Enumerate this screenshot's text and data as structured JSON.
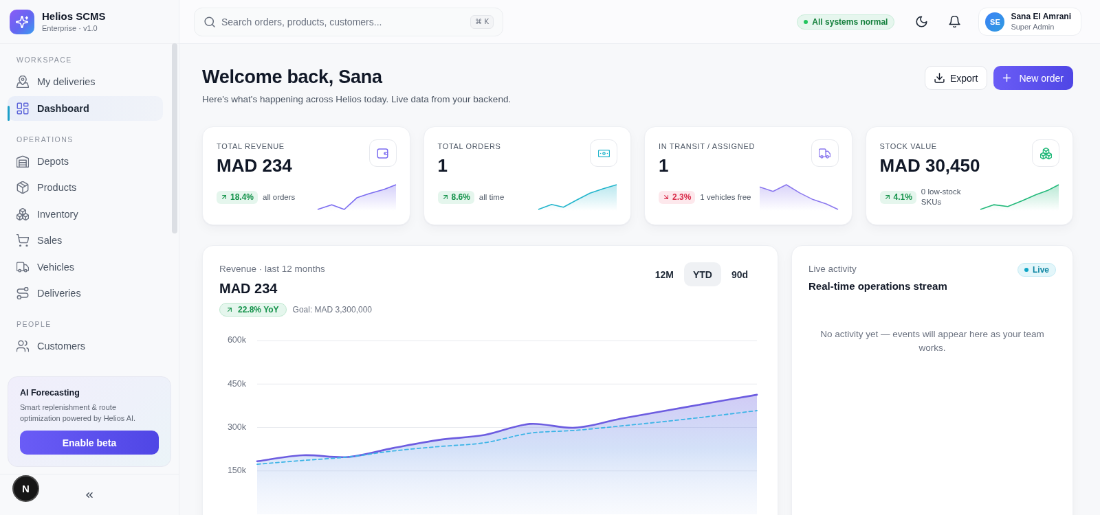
{
  "sidebar": {
    "brand": {
      "name": "Helios SCMS",
      "subtitle": "Enterprise · v1.0"
    },
    "sections": [
      {
        "label": "WORKSPACE",
        "items": [
          {
            "label": "My deliveries",
            "selected": false
          },
          {
            "label": "Dashboard",
            "selected": true
          }
        ]
      },
      {
        "label": "OPERATIONS",
        "items": [
          {
            "label": "Depots",
            "selected": false
          },
          {
            "label": "Products",
            "selected": false
          },
          {
            "label": "Inventory",
            "selected": false
          },
          {
            "label": "Sales",
            "selected": false
          },
          {
            "label": "Vehicles",
            "selected": false
          },
          {
            "label": "Deliveries",
            "selected": false
          }
        ]
      },
      {
        "label": "PEOPLE",
        "items": [
          {
            "label": "Customers",
            "selected": false
          }
        ]
      }
    ],
    "promo": {
      "title": "AI Forecasting",
      "text": "Smart replenishment & route optimization powered by Helios AI.",
      "button": "Enable beta"
    },
    "dev_button": "N"
  },
  "topbar": {
    "search": {
      "placeholder": "Search orders, products, customers...",
      "shortcut": "⌘ K"
    },
    "status": "All systems normal",
    "user": {
      "initials": "SE",
      "name": "Sana El Amrani",
      "role": "Super Admin"
    }
  },
  "header": {
    "title": "Welcome back, Sana",
    "subtitle": "Here's what's happening across Helios today. Live data from your backend.",
    "buttons": [
      {
        "label": "Export",
        "kind": "secondary"
      },
      {
        "label": "New order",
        "kind": "primary"
      }
    ]
  },
  "kpis": [
    {
      "label": "TOTAL REVENUE",
      "value": "MAD 234",
      "delta": "18.4%",
      "down": false,
      "note": "all orders"
    },
    {
      "label": "TOTAL ORDERS",
      "value": "1",
      "delta": "8.6%",
      "down": false,
      "note": "all time"
    },
    {
      "label": "IN TRANSIT / ASSIGNED",
      "value": "1",
      "delta": "2.3%",
      "down": true,
      "note": "1 vehicles free"
    },
    {
      "label": "STOCK VALUE",
      "value": "MAD 30,450",
      "delta": "4.1%",
      "down": false,
      "note": "0 low-stock SKUs"
    }
  ],
  "revenue": {
    "title": "Revenue · last 12 months",
    "value": "MAD 234",
    "delta": "22.8% YoY",
    "down": false,
    "goal": "Goal: MAD 3,300,000",
    "ranges": [
      {
        "label": "12M",
        "selected": false
      },
      {
        "label": "YTD",
        "selected": true
      },
      {
        "label": "90d",
        "selected": false
      }
    ],
    "chart_data": {
      "type": "area",
      "grid": true,
      "series": [
        {
          "color": "#6c5ce0",
          "line_style": "solid",
          "values": [
            183,
            204,
            198,
            229,
            257,
            274,
            312,
            299,
            330,
            358,
            386,
            413
          ]
        },
        {
          "color": "#3cb4e6",
          "type": "line",
          "line_style": "dashed",
          "values": [
            173,
            186,
            198,
            219,
            234,
            247,
            280,
            290,
            305,
            321,
            339,
            358
          ]
        }
      ],
      "ylim": [
        0,
        600
      ],
      "yticks": [
        {
          "value": 150,
          "label": "150k"
        },
        {
          "value": 300,
          "label": "300k"
        },
        {
          "value": 450,
          "label": "450k"
        },
        {
          "value": 600,
          "label": "600k"
        }
      ]
    }
  },
  "activity": {
    "title": "Live activity",
    "subtitle": "Real-time operations stream",
    "badge": "Live",
    "empty": "No activity yet — events will appear here as your team works."
  }
}
